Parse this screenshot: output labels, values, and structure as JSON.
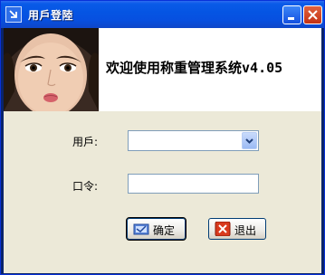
{
  "window": {
    "title": "用戶登陸",
    "title_icon": "app-arrow-icon",
    "minimize_icon": "minimize-icon",
    "close_icon": "close-icon"
  },
  "banner": {
    "text": "欢迎使用称重管理系统v4.05",
    "image": "woman-portrait-photo"
  },
  "form": {
    "user_label": "用戶:",
    "user_value": "",
    "password_label": "口令:",
    "password_value": ""
  },
  "buttons": {
    "ok_label": "确定",
    "ok_icon": "confirm-icon",
    "exit_label": "退出",
    "exit_icon": "exit-x-icon"
  },
  "colors": {
    "titlebar": "#0555e3",
    "client_bg": "#ece9d8",
    "close_button": "#c43215",
    "exit_icon": "#d83a1e"
  }
}
